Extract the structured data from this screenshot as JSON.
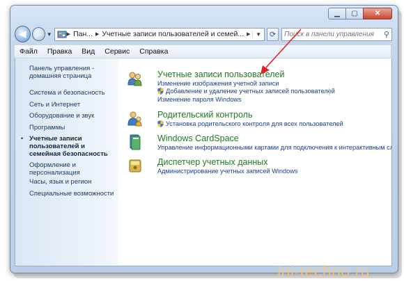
{
  "navigation": {
    "back_icon": "back-arrow-icon",
    "forward_icon": "forward-arrow-icon",
    "address_crumbs": [
      "Пан...",
      "Учетные записи пользователей и семей..."
    ],
    "search_placeholder": "Поиск в панели управления"
  },
  "menu": [
    "Файл",
    "Правка",
    "Вид",
    "Сервис",
    "Справка"
  ],
  "sidebar": {
    "items": [
      {
        "label": "Панель управления - домашняя страница"
      },
      {
        "label": "Система и безопасность"
      },
      {
        "label": "Сеть и Интернет"
      },
      {
        "label": "Оборудование и звук"
      },
      {
        "label": "Программы"
      },
      {
        "label": "Учетные записи пользователей и семейная безопасность",
        "current": true
      },
      {
        "label": "Оформление и персонализация"
      },
      {
        "label": "Часы, язык и регион"
      },
      {
        "label": "Специальные возможности"
      }
    ]
  },
  "categories": [
    {
      "title": "Учетные записи пользователей",
      "icon": "user-accounts-icon",
      "links": [
        "Изменение изображения учетной записи",
        "Добавление и удаление учетных записей пользователей",
        "Изменение пароля Windows"
      ]
    },
    {
      "title": "Родительский контроль",
      "icon": "parental-controls-icon",
      "links": [
        "Установка родительского контроля для всех пользователей"
      ]
    },
    {
      "title": "Windows CardSpace",
      "icon": "cardspace-icon",
      "links": [
        "Управление информационными картами для подключения к интерактивным служб"
      ]
    },
    {
      "title": "Диспетчер учетных данных",
      "icon": "credential-manager-icon",
      "links": [
        "Администрирование учетных записей Windows"
      ]
    }
  ],
  "watermark": "ini-techno.ru",
  "colors": {
    "category_title": "#1f7a1f",
    "link": "#16418c",
    "annotation_arrow": "#e0202a"
  }
}
